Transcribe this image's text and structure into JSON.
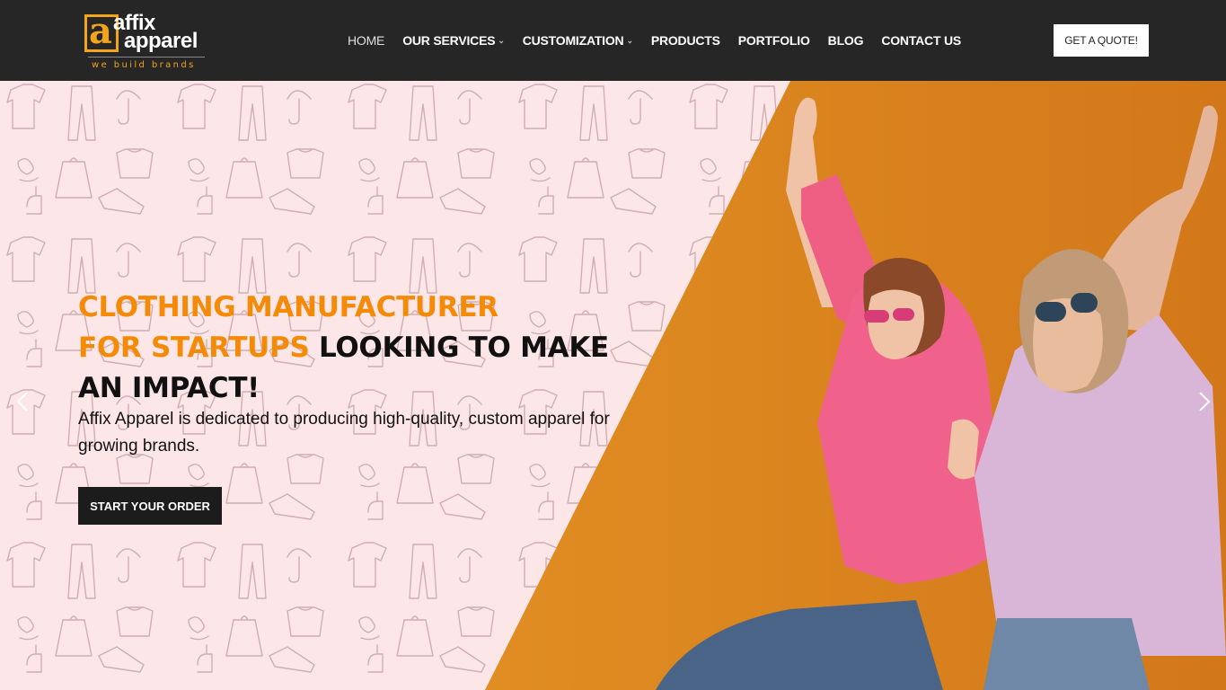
{
  "header": {
    "logo": {
      "letter": "a",
      "line1": "affix",
      "line2": "apparel",
      "tagline": "we build brands"
    },
    "nav": [
      {
        "label": "HOME",
        "dropdown": false
      },
      {
        "label": "OUR SERVICES",
        "dropdown": true
      },
      {
        "label": "CUSTOMIZATION",
        "dropdown": true
      },
      {
        "label": "PRODUCTS",
        "dropdown": false
      },
      {
        "label": "PORTFOLIO",
        "dropdown": false
      },
      {
        "label": "BLOG",
        "dropdown": false
      },
      {
        "label": "CONTACT US",
        "dropdown": false
      }
    ],
    "cta_label": "GET A QUOTE!"
  },
  "hero": {
    "title_orange_1": "CLOTHING MANUFACTURER",
    "title_orange_2": "FOR STARTUPS",
    "title_dark_1": " LOOKING TO MAKE",
    "title_dark_2": "AN IMPACT!",
    "subtitle": "Affix Apparel is dedicated to producing high-quality, custom apparel for growing brands.",
    "button_label": "START YOUR ORDER",
    "prev_icon": "chevron-left-icon",
    "next_icon": "chevron-right-icon"
  },
  "colors": {
    "header_bg": "#262626",
    "accent_orange": "#f58a07",
    "logo_orange": "#f2a51a",
    "hero_pink": "#fde6e7",
    "hero_orange": "#d9821c",
    "button_dark": "#1c1c1c"
  }
}
